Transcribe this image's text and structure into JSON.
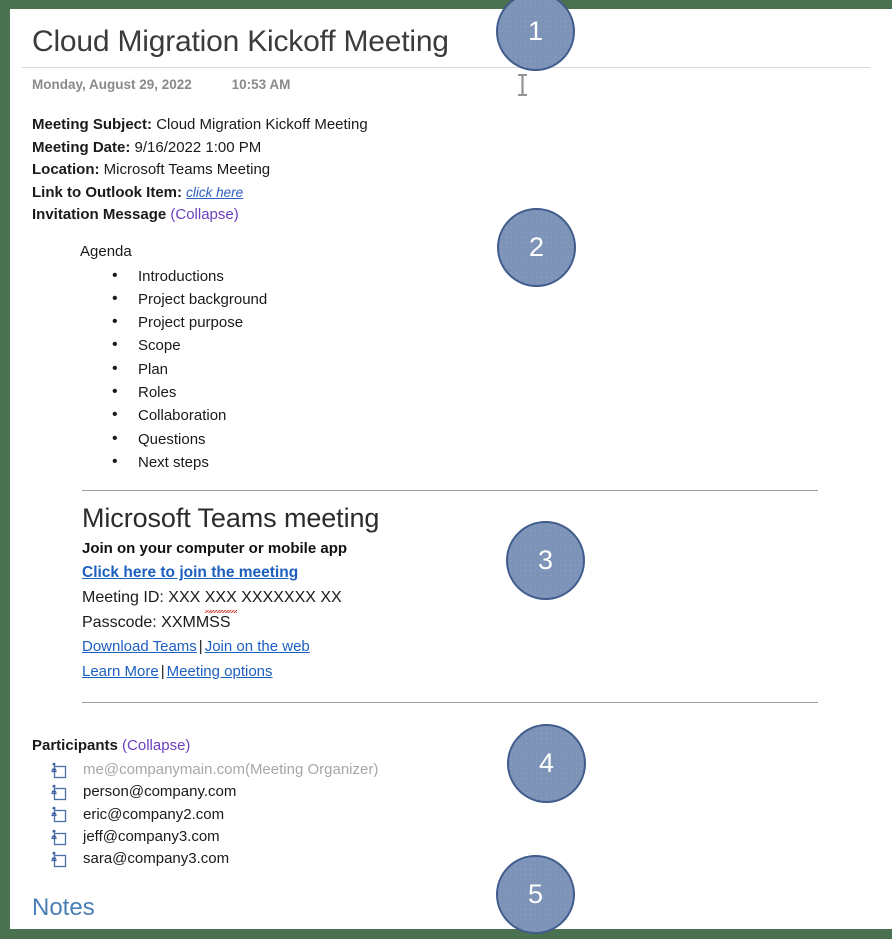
{
  "document": {
    "title": "Cloud Migration Kickoff Meeting",
    "date": "Monday, August 29, 2022",
    "time": "10:53 AM"
  },
  "fields": {
    "subject_label": "Meeting Subject:",
    "subject_value": "Cloud Migration Kickoff Meeting",
    "date_label": "Meeting Date:",
    "date_value": "9/16/2022 1:00 PM",
    "location_label": "Location:",
    "location_value": "Microsoft Teams Meeting",
    "outlook_label": "Link to Outlook Item:",
    "outlook_link": "click here",
    "invitation_label": "Invitation Message",
    "invitation_collapse": "(Collapse)"
  },
  "agenda": {
    "heading": "Agenda",
    "items": [
      "Introductions",
      "Project background",
      "Project purpose",
      "Scope",
      "Plan",
      "Roles",
      "Collaboration",
      "Questions",
      "Next steps"
    ]
  },
  "teams": {
    "title": "Microsoft Teams meeting",
    "subtitle": "Join on your computer or mobile app",
    "join_link": "Click here to join the meeting",
    "meeting_id_label": "Meeting ID:",
    "meeting_id_part1": "XXX",
    "meeting_id_part2": "XXX",
    "meeting_id_part3": "XXXXXXX XX",
    "passcode_label": "Passcode:",
    "passcode_value": "XXMMSS",
    "download_teams": "Download Teams",
    "join_web": "Join on the web",
    "learn_more": "Learn More",
    "meeting_options": "Meeting options",
    "separator": "|"
  },
  "participants": {
    "heading": "Participants",
    "collapse": "(Collapse)",
    "items": [
      {
        "email": "me@companymain.com(Meeting Organizer)",
        "muted": true
      },
      {
        "email": "person@company.com",
        "muted": false
      },
      {
        "email": "eric@company2.com",
        "muted": false
      },
      {
        "email": "jeff@company3.com",
        "muted": false
      },
      {
        "email": "sara@company3.com",
        "muted": false
      }
    ]
  },
  "notes": {
    "heading": "Notes"
  },
  "callouts": [
    {
      "number": "1"
    },
    {
      "number": "2"
    },
    {
      "number": "3"
    },
    {
      "number": "4"
    },
    {
      "number": "5"
    }
  ],
  "colors": {
    "frame_green": "#4a7150",
    "badge_fill": "#7d93b8",
    "badge_border": "#3f5c8c",
    "link_blue": "#1d5fbf",
    "collapse_purple": "#6b3fbf",
    "notes_blue": "#4a7fb5",
    "muted_gray": "#a6a6a6"
  }
}
